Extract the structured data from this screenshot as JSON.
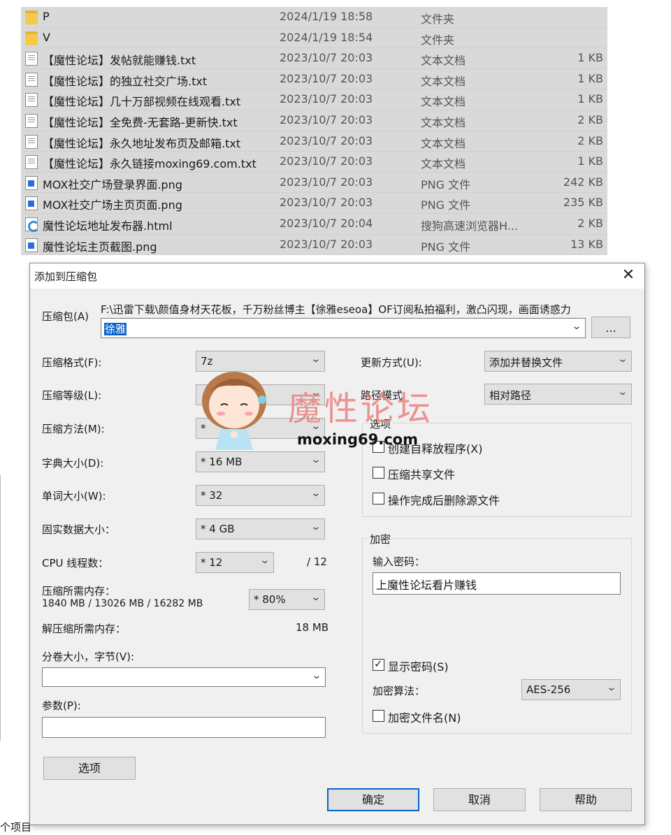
{
  "files": [
    {
      "icon": "folder-icon",
      "name": "P",
      "date": "2024/1/19 18:58",
      "type": "文件夹",
      "size": ""
    },
    {
      "icon": "folder-icon",
      "name": "V",
      "date": "2024/1/19 18:54",
      "type": "文件夹",
      "size": ""
    },
    {
      "icon": "text-file-icon",
      "name": "【魔性论坛】发帖就能赚钱.txt",
      "date": "2023/10/7 20:03",
      "type": "文本文档",
      "size": "1 KB"
    },
    {
      "icon": "text-file-icon",
      "name": "【魔性论坛】的独立社交广场.txt",
      "date": "2023/10/7 20:03",
      "type": "文本文档",
      "size": "1 KB"
    },
    {
      "icon": "text-file-icon",
      "name": "【魔性论坛】几十万部视频在线观看.txt",
      "date": "2023/10/7 20:03",
      "type": "文本文档",
      "size": "1 KB"
    },
    {
      "icon": "text-file-icon",
      "name": "【魔性论坛】全免费-无套路-更新快.txt",
      "date": "2023/10/7 20:03",
      "type": "文本文档",
      "size": "2 KB"
    },
    {
      "icon": "text-file-icon",
      "name": "【魔性论坛】永久地址发布页及邮箱.txt",
      "date": "2023/10/7 20:03",
      "type": "文本文档",
      "size": "2 KB"
    },
    {
      "icon": "text-file-icon",
      "name": "【魔性论坛】永久链接moxing69.com.txt",
      "date": "2023/10/7 20:03",
      "type": "文本文档",
      "size": "1 KB"
    },
    {
      "icon": "image-file-icon",
      "name": "MOX社交广场登录界面.png",
      "date": "2023/10/7 20:03",
      "type": "PNG 文件",
      "size": "242 KB"
    },
    {
      "icon": "image-file-icon",
      "name": "MOX社交广场主页页面.png",
      "date": "2023/10/7 20:03",
      "type": "PNG 文件",
      "size": "235 KB"
    },
    {
      "icon": "html-file-icon",
      "name": "魔性论坛地址发布器.html",
      "date": "2023/10/7 20:04",
      "type": "搜狗高速浏览器H...",
      "size": "2 KB"
    },
    {
      "icon": "image-file-icon",
      "name": "魔性论坛主页截图.png",
      "date": "2023/10/7 20:03",
      "type": "PNG 文件",
      "size": "13 KB"
    }
  ],
  "status_bar": {
    "items_label": "个项目"
  },
  "dialog": {
    "title": "添加到压缩包",
    "close_glyph": "✕",
    "archive": {
      "label": "压缩包(A)",
      "path": "F:\\迅雷下载\\颜值身材天花板，千万粉丝博主【徐雅eseoa】OF订阅私拍福利，激凸闪现，画面诱惑力",
      "name_value": "徐雅",
      "browse_label": "..."
    },
    "left": {
      "format": {
        "label": "压缩格式(F):",
        "value": "7z"
      },
      "level": {
        "label": "压缩等级(L):",
        "value": ""
      },
      "method": {
        "label": "压缩方法(M):",
        "value": "*"
      },
      "dict": {
        "label": "字典大小(D):",
        "value": "* 16 MB"
      },
      "word": {
        "label": "单词大小(W):",
        "value": "* 32"
      },
      "solid": {
        "label": "固实数据大小：",
        "value": "* 4 GB"
      },
      "cpu": {
        "label": "CPU 线程数：",
        "value": "* 12",
        "max": "/ 12"
      },
      "mem": {
        "label": "压缩所需内存：",
        "detail": "1840 MB / 13026 MB / 16282 MB",
        "value": "* 80%"
      },
      "decomp": {
        "label": "解压缩所需内存：",
        "value": "18 MB"
      },
      "volume": {
        "label": "分卷大小，字节(V):",
        "value": ""
      },
      "params": {
        "label": "参数(P):",
        "value": ""
      },
      "options_button": "选项"
    },
    "right": {
      "update": {
        "label": "更新方式(U):",
        "value": "添加并替换文件"
      },
      "path_mode": {
        "label": "路径模式",
        "value": "相对路径"
      },
      "options_group": {
        "title": "选项",
        "sfx": "创建自释放程序(X)",
        "shared": "压缩共享文件",
        "delete": "操作完成后删除源文件"
      },
      "encrypt_group": {
        "title": "加密",
        "pw_label": "输入密码：",
        "pw_value": "上魔性论坛看片赚钱",
        "show_pw": "显示密码(S)",
        "method_label": "加密算法：",
        "method_value": "AES-256",
        "encrypt_names": "加密文件名(N)"
      }
    },
    "buttons": {
      "ok": "确定",
      "cancel": "取消",
      "help": "帮助"
    }
  },
  "watermark": {
    "text": "魔性论坛",
    "url": "moxing69.com"
  },
  "colors": {
    "selection": "#0a62c9",
    "watermark": "#e9837f",
    "file_row": "#d9d9d9"
  }
}
